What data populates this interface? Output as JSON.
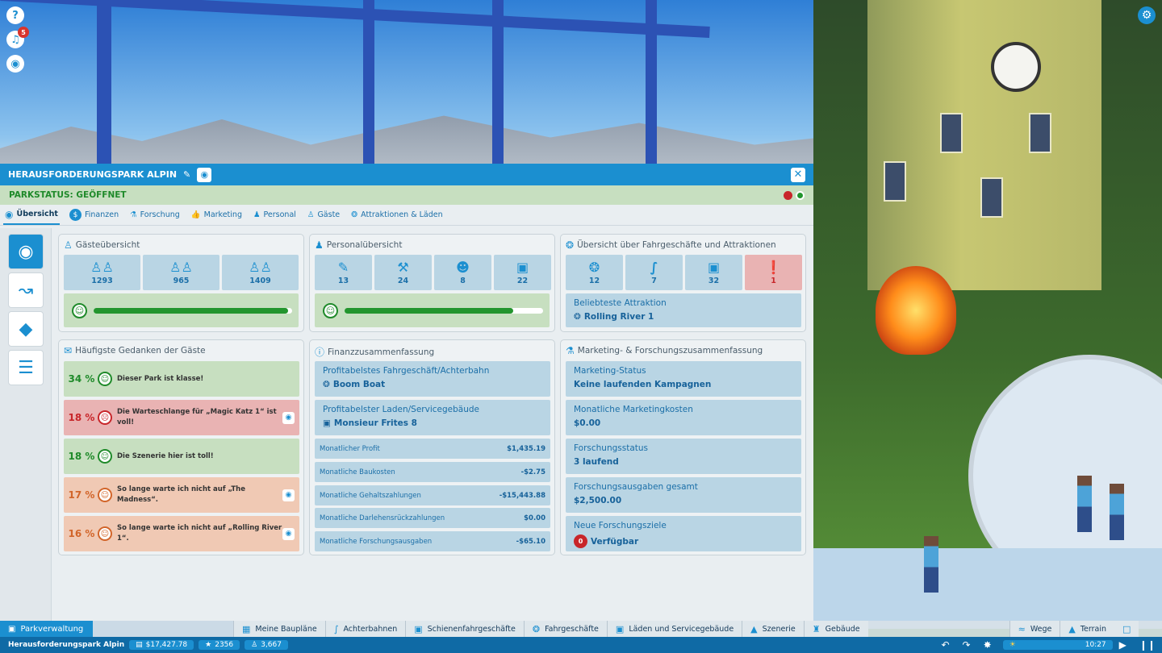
{
  "top_icons": {
    "help": "?",
    "notifications_count": "5"
  },
  "park": {
    "name": "HERAUSFORDERUNGSPARK ALPIN",
    "status": "PARKSTATUS: GEÖFFNET"
  },
  "tabs": [
    "Übersicht",
    "Finanzen",
    "Forschung",
    "Marketing",
    "Personal",
    "Gäste",
    "Attraktionen & Läden"
  ],
  "guests": {
    "title": "Gästeübersicht",
    "counts": [
      "1293",
      "965",
      "1409"
    ],
    "happiness": 0.98
  },
  "staff": {
    "title": "Personalübersicht",
    "counts": [
      "13",
      "24",
      "8",
      "22"
    ],
    "happiness": 0.85
  },
  "rides": {
    "title": "Übersicht über Fahrgeschäfte und Attraktionen",
    "counts": [
      "12",
      "7",
      "32",
      "1"
    ],
    "fav_label": "Beliebteste Attraktion",
    "fav_value": "Rolling River 1"
  },
  "thoughts": {
    "title": "Häufigste Gedanken der Gäste",
    "items": [
      {
        "pct": "34 %",
        "text": "Dieser Park ist klasse!",
        "mood": "g"
      },
      {
        "pct": "18 %",
        "text": "Die Warteschlange für „Magic Katz 1“ ist voll!",
        "mood": "r"
      },
      {
        "pct": "18 %",
        "text": "Die Szenerie hier ist toll!",
        "mood": "g"
      },
      {
        "pct": "17 %",
        "text": "So lange warte ich nicht auf „The Madness“.",
        "mood": "o"
      },
      {
        "pct": "16 %",
        "text": "So lange warte ich nicht auf „Rolling River 1“.",
        "mood": "o"
      }
    ]
  },
  "finance": {
    "title": "Finanzzusammenfassung",
    "ride_label": "Profitabelstes Fahrgeschäft/Achterbahn",
    "ride_value": "Boom Boat",
    "shop_label": "Profitabelster Laden/Servicegebäude",
    "shop_value": "Monsieur Frites 8",
    "rows": [
      {
        "k": "Monatlicher Profit",
        "v": "$1,435.19"
      },
      {
        "k": "Monatliche Baukosten",
        "v": "-$2.75"
      },
      {
        "k": "Monatliche Gehaltszahlungen",
        "v": "-$15,443.88"
      },
      {
        "k": "Monatliche Darlehensrückzahlungen",
        "v": "$0.00"
      },
      {
        "k": "Monatliche Forschungsausgaben",
        "v": "-$65.10"
      }
    ]
  },
  "marketing": {
    "title": "Marketing- & Forschungszusammenfassung",
    "items": [
      {
        "k": "Marketing-Status",
        "v": "Keine laufenden Kampagnen"
      },
      {
        "k": "Monatliche Marketingkosten",
        "v": "$0.00"
      },
      {
        "k": "Forschungsstatus",
        "v": "3 laufend"
      },
      {
        "k": "Forschungsausgaben gesamt",
        "v": "$2,500.00"
      },
      {
        "k": "Neue Forschungsziele",
        "v": "Verfügbar",
        "badge": "0"
      }
    ]
  },
  "bottom": {
    "park_admin": "Parkverwaltung",
    "tabs": [
      "Meine Baupläne",
      "Achterbahnen",
      "Schienenfahrgeschäfte",
      "Fahrgeschäfte",
      "Läden und Servicegebäude",
      "Szenerie",
      "Gebäude"
    ],
    "right_tabs": [
      "Wege",
      "Terrain"
    ],
    "park_name": "Herausforderungspark Alpin",
    "money": "$17,427.78",
    "rating": "2356",
    "guests": "3,667",
    "time": "10:27"
  },
  "colors": {
    "accent": "#1b8fd0",
    "good": "#1f8a2a",
    "bad": "#c8262a",
    "warn": "#d2652a"
  }
}
